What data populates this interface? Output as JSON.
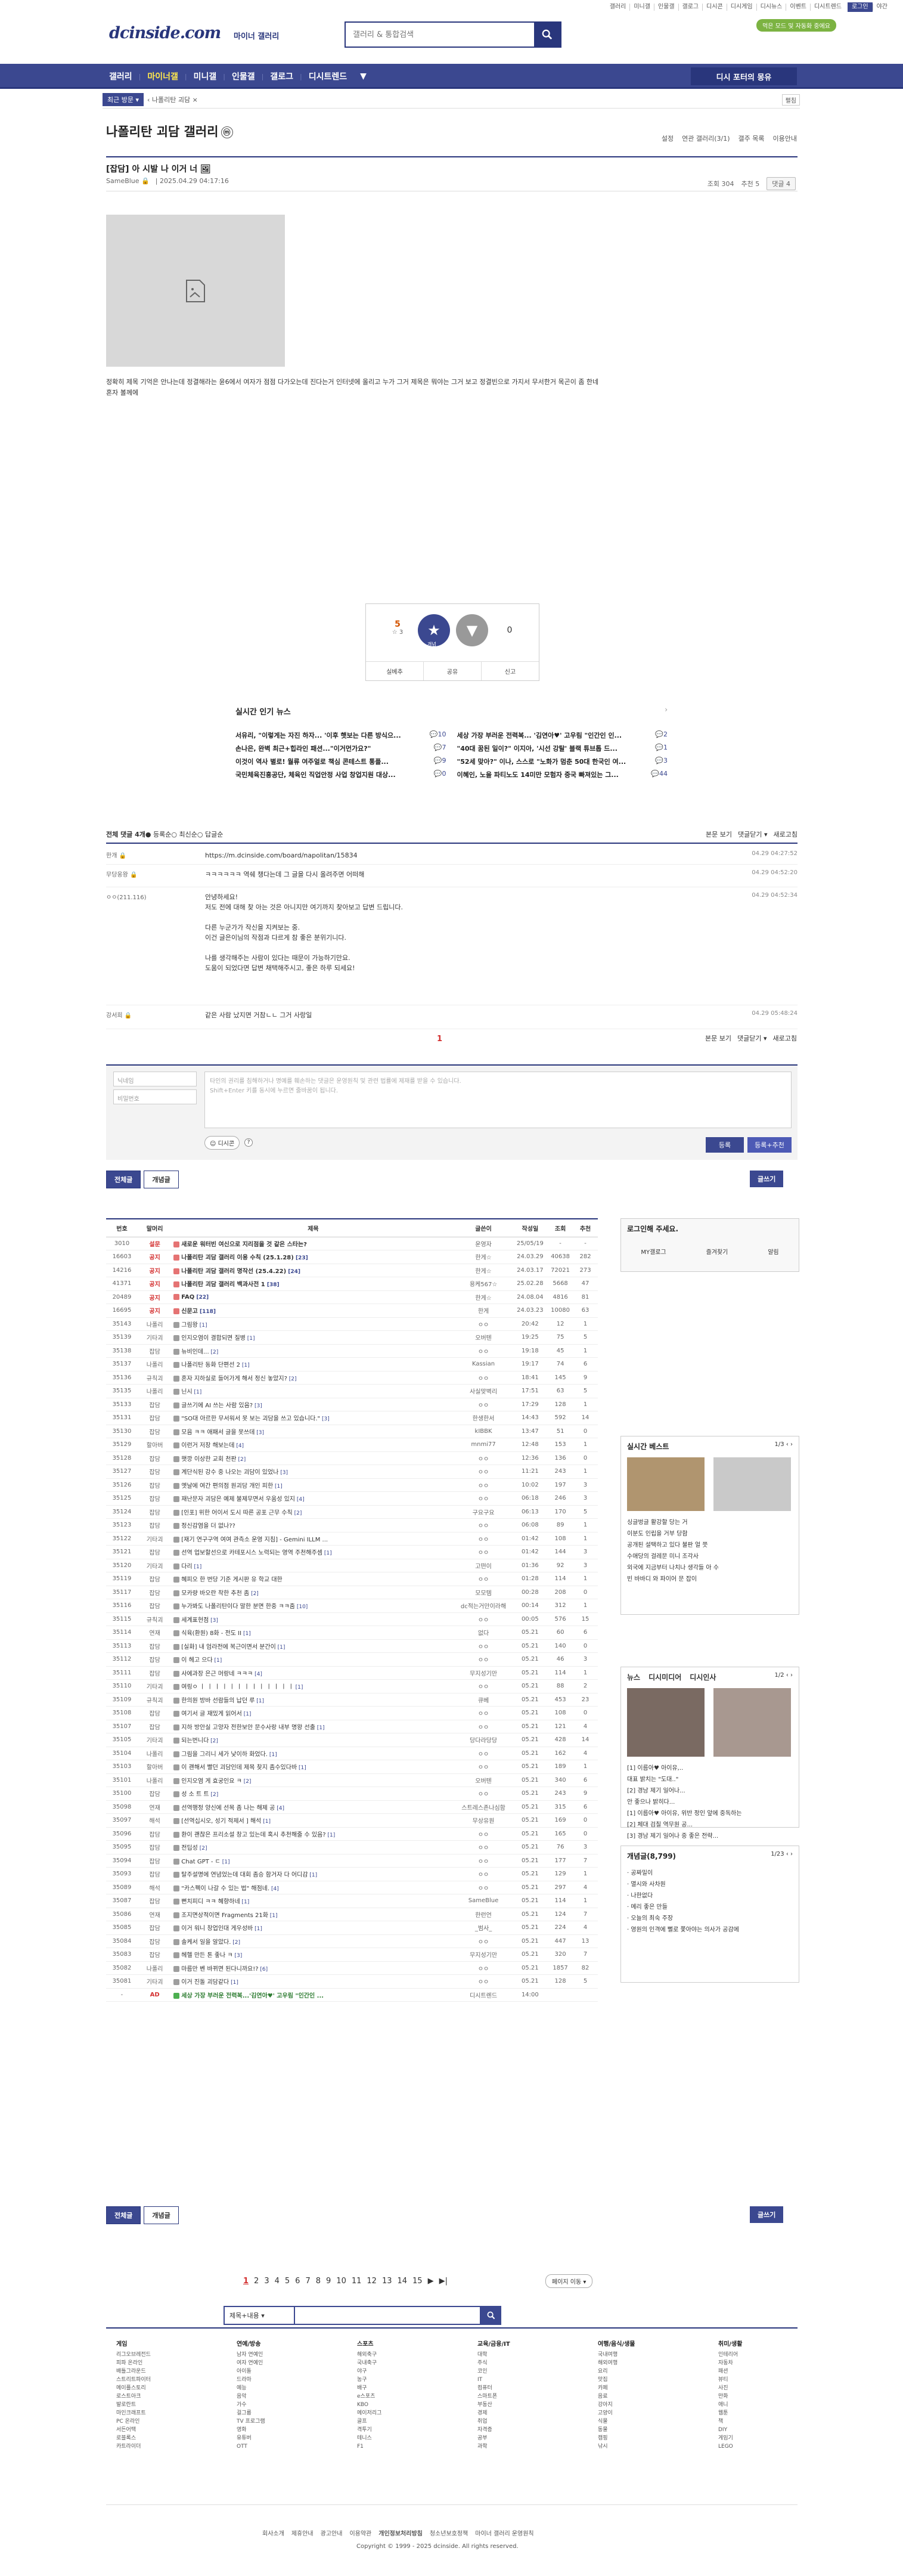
{
  "util": [
    "갤러리",
    "미니갤",
    "인물갤",
    "갤로그",
    "디시콘",
    "디시게임",
    "디시뉴스",
    "이벤트",
    "디시트렌드",
    "로그인",
    "야간"
  ],
  "green_btn": "먹은 모드 및 자동화 중에요",
  "logo": "dcinside.com",
  "logo_sub": "마이너 갤러리",
  "search": {
    "placeholder": "갤러리 & 통합검색"
  },
  "gnb": {
    "items": [
      "갤러리",
      "마이너갤",
      "미니갤",
      "인물갤",
      "갤로그",
      "디시트렌드"
    ],
    "recent": "디시 포터의 몽유"
  },
  "crumb": {
    "recent": "최근 방문",
    "gallery": "나폴리탄 괴담",
    "expand": "펼침"
  },
  "gallery": {
    "title": "나폴리탄 괴담 갤러리",
    "mark": "ⓜ",
    "tools": [
      "설정",
      "연관 갤러리(3/1)",
      "갤주 목록",
      "이용안내"
    ]
  },
  "post": {
    "title": "[잡담] 아 시발 나 이거 너",
    "author": "SameBlue",
    "date": "2025.04.29 04:17:16",
    "views": "조회 304",
    "recommend": "추천 5",
    "comments": "댓글 4",
    "text": "정확히 제목 기억은 안나는데 정결해라는 윤6에서 여자가 점점 다가오는데 진다는거 인터넷에 올리고 누가 그거 제목은 뭐야는 그거 보고 정결빈으로 가지서 무서한거 목곤이 좀 한네 혼자 볼께에"
  },
  "vote": {
    "up_count": "5",
    "up_fixed": "☆ 3",
    "down_count": "0",
    "up_label": "개념",
    "tools": [
      "실베추",
      "공유",
      "신고"
    ]
  },
  "popular": {
    "title": "실시간 인기 뉴스",
    "items": [
      {
        "t": "서유리, \"이렇게는 자진 하자... '이후 햇보는 다른 방식으...",
        "n": "10"
      },
      {
        "t": "세상 가장 부러운 전력복... '김연아♥' 고우림 \"인간인 인...",
        "n": "2"
      },
      {
        "t": "손나은, 완벽 최근+힙라인 패션...\"이거먼가요?\"",
        "n": "7"
      },
      {
        "t": "\"40대 꿈된 일이?\" 이지아, '시선 강탈' 블랙 튜브톱 드...",
        "n": "1"
      },
      {
        "t": "이것이 역사 별로! 월류 여주얼로 책심 콘테스트 통플...",
        "n": "9"
      },
      {
        "t": "\"52세 맞아?\" 이나, 스스로 \"노화가 멈춘 50대 한국인 여...",
        "n": "3"
      },
      {
        "t": "국민체육진흥공단, 체육인 직업안정 사업 창업지원 대상...",
        "n": "0"
      },
      {
        "t": "이혜인, 노을 파티노도 14미만 모험자 중국 빠져있는 그...",
        "n": "44"
      }
    ]
  },
  "comment_head": {
    "label": "전체 댓글 4개",
    "opts": [
      "등록순",
      "최신순",
      "답글순"
    ],
    "right": [
      "본문 보기",
      "댓글닫기 ▾",
      "새로고침"
    ]
  },
  "comments": [
    {
      "nick": "한개 🔒",
      "text": "https://m.dcinside.com/board/napolitan/15834",
      "date": "04.29 04:27:52"
    },
    {
      "nick": "무당웅왕 🔒",
      "text": "ㅋㅋㅋㅋㅋㅋ 역쉐 챙다는데 그 글을 다시 올려주면 어떠해",
      "date": "04.29 04:52:20"
    },
    {
      "nick": "ㅇㅇ(211.116)",
      "text": "안녕하세요!\n저도 전에 대해 찾 아는 것은 아니지만 여기까지 찾아보고 답변 드립니다.\n\n다른 누군가가 작신을 지켜보는 중.\n이건 글은이님의 작점과 다르게 참 좋은 분위기니다.\n\n나를 생각해주는 사람이 있다는 때문이 가능하기만요.\n도움이 되었다면 답변 채택해주시고, 좋은 하루 되세요!",
      "date": "04.29 04:52:34"
    },
    {
      "nick": "강서희 🔒",
      "text": "같은 사람 났지면 거참ㄴㄴ 그거 사랑일",
      "date": "04.29 05:48:24"
    }
  ],
  "comment_page": "1",
  "form": {
    "nick_ph": "닉네임",
    "pw_ph": "비밀번호",
    "ta_ph": "타인의 권리를 침해하거나 명예를 훼손하는 댓글은 운영원칙 및 관련 법률에 제재를 받을 수 있습니다.\nShift+Enter 키를 동시에 누르면 줄바꿈이 됩니다.",
    "dccon": "디시콘",
    "submit": "등록",
    "submit2": "등록+추천"
  },
  "buttons": {
    "all": "전체글",
    "best": "개념글",
    "write": "글쓰기"
  },
  "table": {
    "headers": [
      "번호",
      "말머리",
      "제목",
      "글쓴이",
      "작성일",
      "조회",
      "추천"
    ],
    "rows": [
      [
        "3010",
        "설문",
        "새로운 워터빈 여신으로 지리점을 것 같은 스타는?",
        "운영자",
        "25/05/19",
        "-",
        "-",
        "n"
      ],
      [
        "16603",
        "공지",
        "나폴리탄 괴담 갤러리 이용 수칙 (25.1.28)",
        "[23]",
        "한게☆",
        "24.03.29",
        "40638",
        "282",
        "n"
      ],
      [
        "14216",
        "공지",
        "나폴리탄 괴담 갤러리 명작선 (25.4.22)",
        "[24]",
        "한게☆",
        "24.03.17",
        "72021",
        "273",
        "n"
      ],
      [
        "41371",
        "공지",
        "나폴리탄 괴담 갤러리 백과사전 1",
        "[38]",
        "용케567☆",
        "25.02.28",
        "5668",
        "47",
        "n"
      ],
      [
        "20489",
        "공지",
        "FAQ",
        "[22]",
        "한게☆",
        "24.08.04",
        "4816",
        "81",
        "n"
      ],
      [
        "16695",
        "공지",
        "신문고",
        "[118]",
        "한게",
        "24.03.23",
        "10080",
        "63",
        "n"
      ],
      [
        "35143",
        "나폴리",
        "그림왕",
        "[1]",
        "ㅇㅇ",
        "20:42",
        "12",
        "1"
      ],
      [
        "35139",
        "기타괴",
        "인지오염이 결합되면 질병",
        "[1]",
        "오버텐",
        "19:25",
        "75",
        "5"
      ],
      [
        "35138",
        "잡담",
        "뉴비인데...",
        "[2]",
        "ㅇㅇ",
        "19:18",
        "45",
        "1"
      ],
      [
        "35137",
        "나폴리",
        "나폴리탄 동화 단편선 2",
        "[1]",
        "Kassian",
        "19:17",
        "74",
        "6"
      ],
      [
        "35136",
        "규칙괴",
        "혼자 지하실로 들어가게 해서 정신 놓았지?",
        "[2]",
        "ㅇㅇ",
        "18:41",
        "145",
        "9"
      ],
      [
        "35135",
        "나폴리",
        "닌시",
        "[1]",
        "사실맞벽리",
        "17:51",
        "63",
        "5"
      ],
      [
        "35133",
        "잡담",
        "글쓰기에 AI 쓰는 사람 있음?",
        "[3]",
        "ㅇㅇ",
        "17:29",
        "128",
        "1"
      ],
      [
        "35131",
        "잡담",
        "\"SO대 아르한 무서워서 못 보는 괴담을 쓰고 있습니다.\"",
        "[3]",
        "한생한서",
        "14:43",
        "592",
        "14"
      ],
      [
        "35130",
        "잡담",
        "모음 ㅋㅋ 애패서 글을 못쓰데",
        "[3]",
        "kIBBK",
        "13:47",
        "51",
        "0"
      ],
      [
        "35129",
        "할아버",
        "이런거 저장 해보는데",
        "[4]",
        "mnmi77",
        "12:48",
        "153",
        "1"
      ],
      [
        "35128",
        "잡담",
        "햇깡 이상한 교회 천판",
        "[2]",
        "ㅇㅇ",
        "12:36",
        "136",
        "0"
      ],
      [
        "35127",
        "잡담",
        "계단식된 강수 중 나오는 괴담이 있었나",
        "[3]",
        "ㅇㅇ",
        "11:21",
        "243",
        "1"
      ],
      [
        "35126",
        "잡담",
        "옛날에 여간 편의점 원괴담 개인 피한",
        "[1]",
        "ㅇㅇ",
        "10:02",
        "197",
        "3"
      ],
      [
        "35125",
        "잡담",
        "재난문자 괴담은 예제 불제무면서 우움성 있지",
        "[4]",
        "ㅇㅇ",
        "06:18",
        "246",
        "3"
      ],
      [
        "35124",
        "잡담",
        "[인포] 위한 어이서 도시 따른 공포 근무 수칙",
        "[2]",
        "구요구요",
        "06:13",
        "170",
        "5"
      ],
      [
        "35123",
        "잡담",
        "정신감염을 더 없나??",
        "",
        "ㅇㅇ",
        "06:08",
        "89",
        "1"
      ],
      [
        "35122",
        "기타괴",
        "[재기 연구구역 여여 관측소 운영 지침] - Gemini ILLM ...",
        "",
        "ㅇㅇ",
        "01:42",
        "108",
        "1"
      ],
      [
        "35121",
        "잡담",
        "선역 업보할선으로 카테포시스 노력되는 영역 주천해주셈",
        "[1]",
        "ㅇㅇ",
        "01:42",
        "144",
        "3"
      ],
      [
        "35120",
        "기타괴",
        "다리",
        "[1]",
        "고떤이",
        "01:36",
        "92",
        "3"
      ],
      [
        "35119",
        "잡담",
        "혜피오 한 번당 기준 게시판 유 학교 대한",
        "",
        "ㅇㅇ",
        "01:28",
        "114",
        "1"
      ],
      [
        "35117",
        "잡담",
        "모카량 바오란 착한 추천 좀",
        "[2]",
        "모모템",
        "00:28",
        "208",
        "0"
      ],
      [
        "35116",
        "잡담",
        "누가봐도 나폴리탄이다 말한 분면 한중 ㅋㅋ줌",
        "[10]",
        "dc적는거만이라해",
        "00:14",
        "312",
        "1"
      ],
      [
        "35115",
        "규칙괴",
        "세계표현점",
        "[3]",
        "ㅇㅇ",
        "00:05",
        "576",
        "15"
      ],
      [
        "35114",
        "연재",
        "식육(환원) 8화 - 전도 II",
        "[1]",
        "없다",
        "05.21",
        "60",
        "6"
      ],
      [
        "35113",
        "잡담",
        "[실화] 내 엄라전에 복근이면서 분간이",
        "[1]",
        "ㅇㅇ",
        "05.21",
        "140",
        "0"
      ],
      [
        "35112",
        "잡담",
        "이 헤고 으다",
        "[1]",
        "ㅇㅇ",
        "05.21",
        "46",
        "3"
      ],
      [
        "35111",
        "잡담",
        "사에과장 은근 머랑네 ㅋㅋㅋ",
        "[4]",
        "무지성기만",
        "05.21",
        "114",
        "1"
      ],
      [
        "35110",
        "기타괴",
        "여링ㅇ ㅣ ㅣ ㅣ ㅣ ㅣ ㅣ ㅣ ㅣ ㅣ ㅣ ㅣ ㅣ ㅣ",
        "[1]",
        "ㅇㅇ",
        "05.21",
        "88",
        "2"
      ],
      [
        "35109",
        "규칙괴",
        "한의원 방바 선람들의 납던 루",
        "[1]",
        "큐베",
        "05.21",
        "453",
        "23"
      ],
      [
        "35108",
        "잡담",
        "여기서 글 재밌게 읽어서",
        "[1]",
        "ㅇㅇ",
        "05.21",
        "108",
        "0"
      ],
      [
        "35107",
        "잡담",
        "지하 방안실 고양자 전한보안 문수사랑 내부 명왕 선출",
        "[1]",
        "ㅇㅇ",
        "05.21",
        "121",
        "4"
      ],
      [
        "35105",
        "기타괴",
        "되는번니다",
        "[2]",
        "당다라당당",
        "05.21",
        "428",
        "14"
      ],
      [
        "35104",
        "나폴리",
        "그림을 그리니 세가 낯이하 화었다.",
        "[1]",
        "ㅇㅇ",
        "05.21",
        "162",
        "4"
      ],
      [
        "35103",
        "할아버",
        "이 괜해서 빨던 괴담인데 제목 찾지 좀수있다바",
        "[1]",
        "ㅇㅇ",
        "05.21",
        "189",
        "1"
      ],
      [
        "35101",
        "나폴리",
        "인지오염 게 효궁인요 ㅋ",
        "[2]",
        "오버텐",
        "05.21",
        "340",
        "6"
      ],
      [
        "35100",
        "잡담",
        "성 소 트 트",
        "[2]",
        "ㅇㅇ",
        "05.21",
        "243",
        "9"
      ],
      [
        "35098",
        "연재",
        "선역행정 양신에 선목 좀 나는 해제 공",
        "[4]",
        "스트레스존나심함",
        "05.21",
        "315",
        "6"
      ],
      [
        "35097",
        "해석",
        "[선역십시오, 성기 적제서 ] 해석",
        "[1]",
        "무상유원",
        "05.21",
        "169",
        "0"
      ],
      [
        "35096",
        "잡담",
        "환이 괜찮은 프리소설 창고 있는데 혹시 추천해줄 수 있음?",
        "[1]",
        "ㅇㅇ",
        "05.21",
        "165",
        "0"
      ],
      [
        "35095",
        "잡담",
        "전딥성",
        "[2]",
        "ㅇㅇ",
        "05.21",
        "76",
        "3"
      ],
      [
        "35094",
        "잡담",
        "Chat GPT - ㄷ",
        "[1]",
        "ㅇㅇ",
        "05.21",
        "177",
        "7"
      ],
      [
        "35093",
        "잡담",
        "탈주설명에 연념었는데 대회 좀승 함거자 다 어디감",
        "[1]",
        "ㅇㅇ",
        "05.21",
        "129",
        "1"
      ],
      [
        "35089",
        "해석",
        "\"카스펙이 나갈 수 있는 법\" 해점네.",
        "[4]",
        "ㅇㅇ",
        "05.21",
        "297",
        "4"
      ],
      [
        "35087",
        "잡담",
        "뻔치피디 ㅋㅋ 혜향하네",
        "[1]",
        "SameBlue",
        "05.21",
        "114",
        "1"
      ],
      [
        "35086",
        "연재",
        "조지면상적이면 Fragments 21화",
        "[1]",
        "한런언",
        "05.21",
        "124",
        "7"
      ],
      [
        "35085",
        "잡담",
        "이거 워니 창업인대 게우성바",
        "[1]",
        "_범사_",
        "05.21",
        "224",
        "4"
      ],
      [
        "35084",
        "잡담",
        "솔케서 일을 알았다.",
        "[2]",
        "ㅇㅇ",
        "05.21",
        "447",
        "13"
      ],
      [
        "35083",
        "잡담",
        "헤헬 만든 톤 좋나 ㅋ",
        "[3]",
        "무지성기만",
        "05.21",
        "320",
        "7"
      ],
      [
        "35082",
        "나폴리",
        "마름만 벤 바뀌면 된다니까요!?",
        "[6]",
        "ㅇㅇ",
        "05.21",
        "1857",
        "82"
      ],
      [
        "35081",
        "기타괴",
        "이거 진돌 괴담같다",
        "[1]",
        "ㅇㅇ",
        "05.21",
        "128",
        "5"
      ],
      [
        "-",
        "AD",
        "세상 가장 부러운 전력복...'김연아♥' 고우림 \"인간인 ...",
        "",
        "디시트렌드",
        "14:00",
        "",
        ""
      ]
    ]
  },
  "side_login": {
    "title": "로그인해 주세요.",
    "items": [
      "MY갤로그",
      "즐겨찾기",
      "알림"
    ]
  },
  "side_best": {
    "title": "실시간 베스트",
    "page": "1/3",
    "items": [
      "싱글벙글 활강할 당는 거",
      "이분도 인립을 거부 당함",
      "공개된 설택하고 있다 불판 얼 쯧",
      "수애당의 걸레문 미니 조각사",
      "외국에 지금부터 나치나 생각들 아 수",
      "빈 바바디 와 파이어 문 잡이"
    ]
  },
  "side_news": {
    "tabs": [
      "뉴스",
      "디시미디어",
      "디시인사"
    ],
    "page": "1/2",
    "caps": [
      "[1] 이름아♥ 아이유,..",
      "대표 밝치는 \"도대..\"",
      "[2] 경남 제기 일어나...",
      "안 좋으나 밝히다..."
    ],
    "items": [
      "[1] 이름아♥ 아이유, 위반 정인 앞에 중독하는",
      "[2] 체대 검칠 역무원 공...",
      "[3] 경남 제기 일어나 중 좋은 전략..."
    ]
  },
  "side_mini": {
    "title": "개념글(8,799)",
    "page": "1/23",
    "items": [
      "공짜밀이",
      "멸시와 사차원",
      "나한없다",
      "메리 좋은 만들",
      "오늘의 최숙 주장",
      "영원의 인격에 뻘로 쫓아야는 의사가 공감에"
    ]
  },
  "pager": {
    "pages": [
      "1",
      "2",
      "3",
      "4",
      "5",
      "6",
      "7",
      "8",
      "9",
      "10",
      "11",
      "12",
      "13",
      "14",
      "15"
    ],
    "next": "▶",
    "end": "▶|",
    "jump": "페이지 이동 ▾"
  },
  "search_sel": "제목+내용",
  "footer": {
    "cols": [
      {
        "h": "게임",
        "items": [
          "리그오브레전드",
          "피파 온라인",
          "배틀그라운드",
          "스트리트파이터",
          "메이플스토리",
          "로스트아크",
          "발로란트",
          "마인크래프트",
          "PC 온라인",
          "서든어택",
          "로블록스",
          "카트라이더"
        ]
      },
      {
        "h": "연예/방송",
        "items": [
          "남자 연예인",
          "여자 연예인",
          "아이돌",
          "드라마",
          "예능",
          "음악",
          "가수",
          "걸그룹",
          "TV 프로그램",
          "영화",
          "유튜버",
          "OTT"
        ]
      },
      {
        "h": "스포츠",
        "items": [
          "해외축구",
          "국내축구",
          "야구",
          "농구",
          "배구",
          "e스포츠",
          "KBO",
          "메이저리그",
          "골프",
          "격투기",
          "테니스",
          "F1"
        ]
      },
      {
        "h": "교육/금융/IT",
        "items": [
          "대학",
          "주식",
          "코인",
          "IT",
          "컴퓨터",
          "스마트폰",
          "부동산",
          "경제",
          "취업",
          "자격증",
          "공부",
          "과학"
        ]
      },
      {
        "h": "여행/음식/생물",
        "items": [
          "국내여행",
          "해외여행",
          "요리",
          "맛집",
          "카페",
          "음료",
          "강아지",
          "고양이",
          "식물",
          "동물",
          "캠핑",
          "낚시"
        ]
      },
      {
        "h": "취미/생활",
        "items": [
          "인테리어",
          "자동차",
          "패션",
          "뷰티",
          "사진",
          "만화",
          "애니",
          "웹툰",
          "책",
          "DIY",
          "게임기",
          "LEGO"
        ]
      }
    ],
    "links": [
      "회사소개",
      "제휴안내",
      "광고안내",
      "이용약관",
      "개인정보처리방침",
      "청소년보호정책",
      "마이너 갤러리 운영원칙"
    ],
    "copy": "Copyright © 1999 - 2025 dcinside. All rights reserved."
  }
}
